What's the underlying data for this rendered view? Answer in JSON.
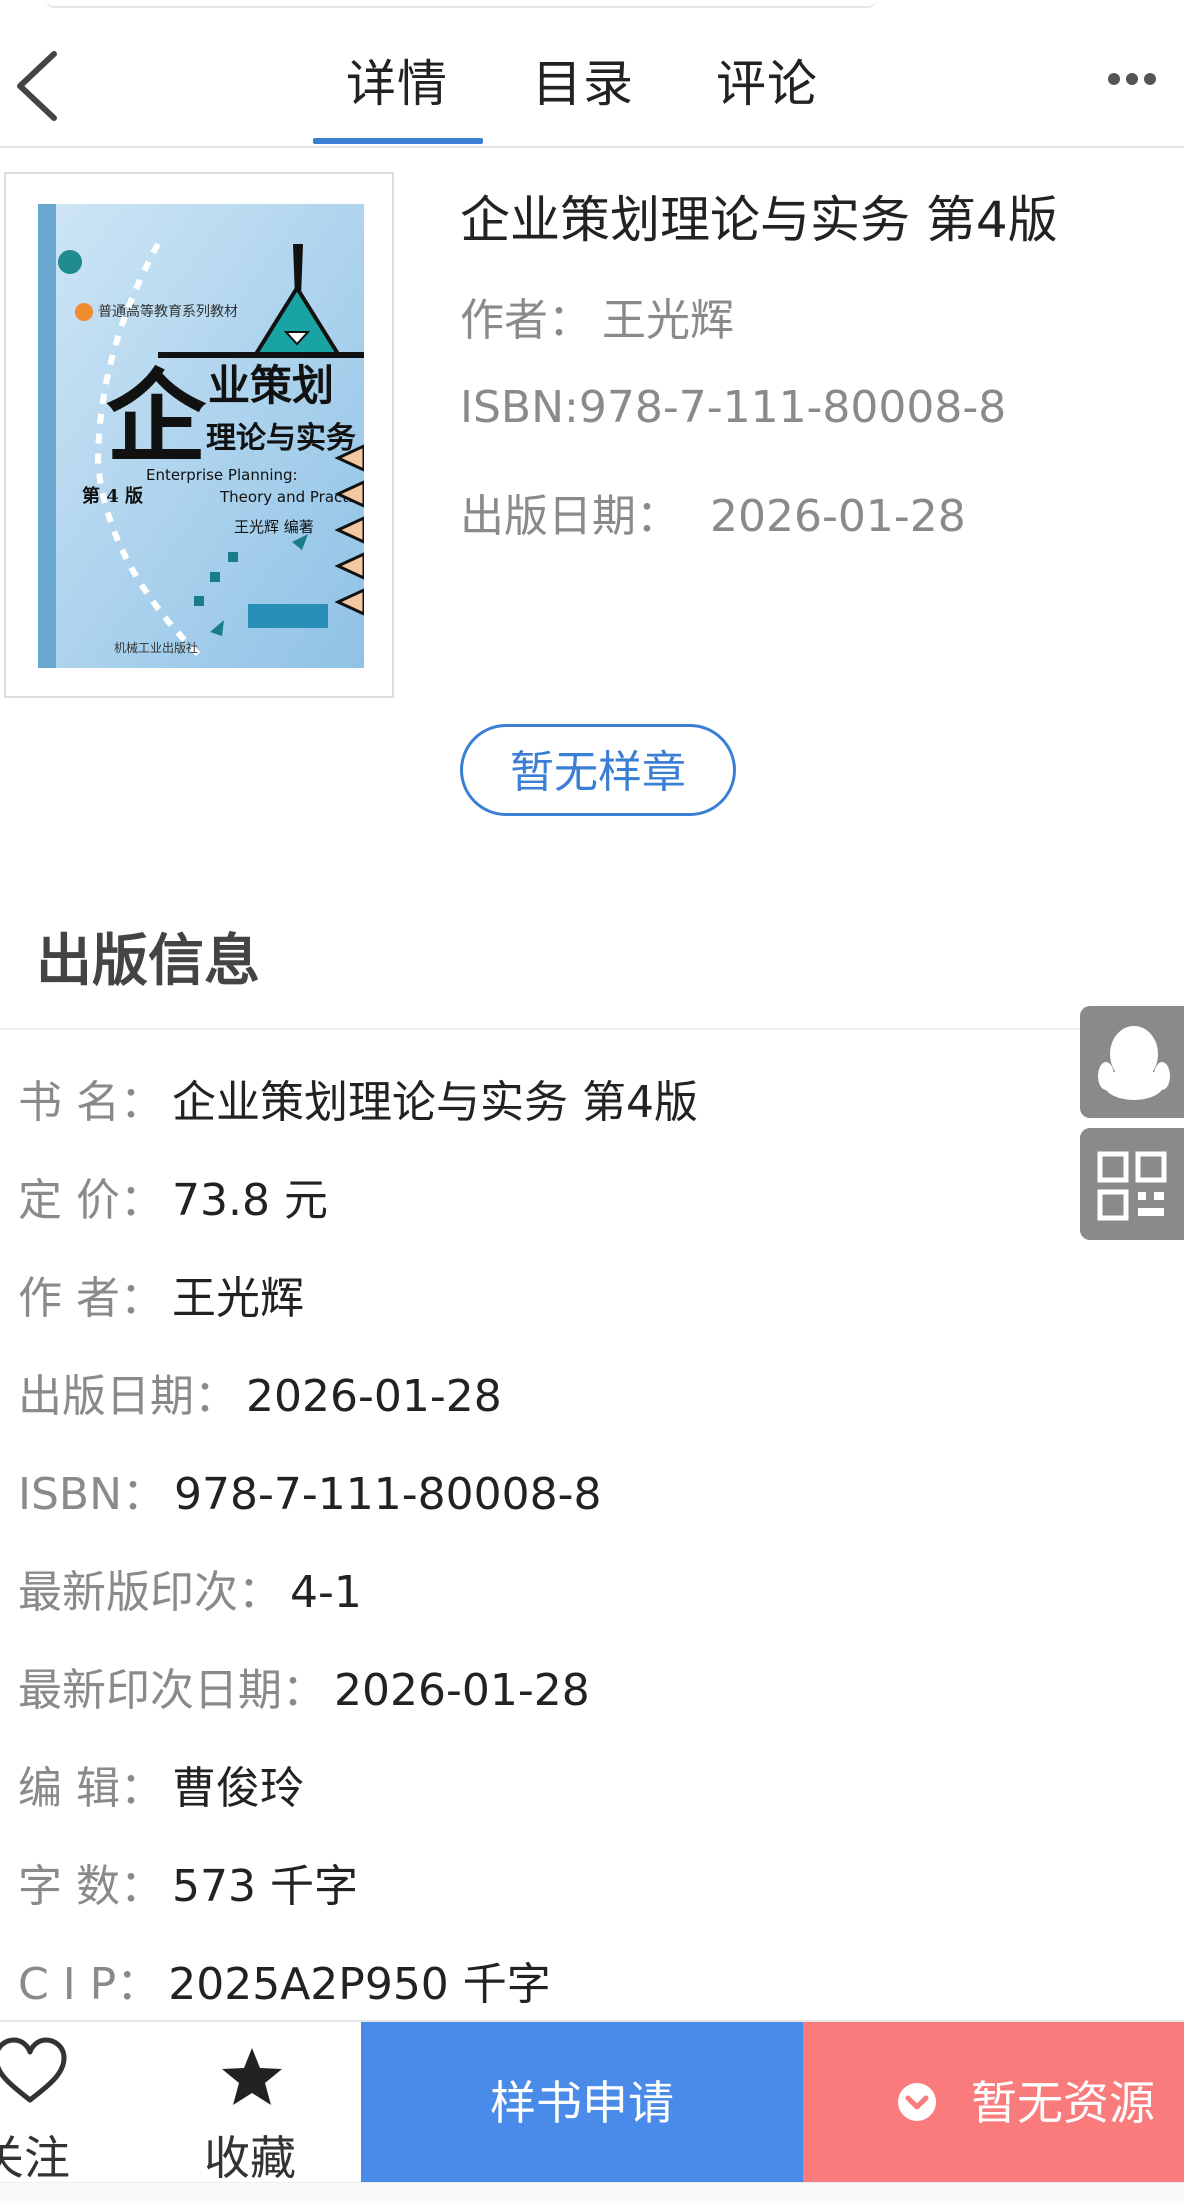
{
  "header": {
    "tabs": [
      "详情",
      "目录",
      "评论"
    ],
    "active_tab": "详情"
  },
  "book": {
    "title": "企业策划理论与实务 第4版",
    "author_label": "作者：",
    "author": "王光辉",
    "isbn_label": "ISBN:",
    "isbn": "978-7-111-80008-8",
    "date_label": "出版日期：",
    "date": "2026-01-28"
  },
  "cover": {
    "series": "普通高等教育系列教材",
    "title_big": "企",
    "title_line1": "业策划",
    "title_line2": "理论与实务",
    "subtitle_en_1": "Enterprise Planning:",
    "subtitle_en_2": "Theory and Practice",
    "edition": "第 4 版",
    "author": "王光辉  编著",
    "spine_title": "企业策划理论与实务",
    "publisher": "机械工业出版社"
  },
  "sample_button": "暂无样章",
  "publish_info": {
    "heading": "出版信息",
    "rows": [
      {
        "label": "书  名：",
        "value": "企业策划理论与实务 第4版"
      },
      {
        "label": "定  价：",
        "value": "73.8 元"
      },
      {
        "label": "作  者：",
        "value": "王光辉"
      },
      {
        "label": "出版日期：",
        "value": "2026-01-28"
      },
      {
        "label": "ISBN：",
        "value": "978-7-111-80008-8"
      },
      {
        "label": "最新版印次：",
        "value": "4-1"
      },
      {
        "label": "最新印次日期：",
        "value": "2026-01-28"
      },
      {
        "label": "编  辑：",
        "value": "曹俊玲"
      },
      {
        "label": "字  数：",
        "value": "573 千字"
      },
      {
        "label": "C I P：",
        "value": "2025A2P950 千字"
      }
    ]
  },
  "bottom_bar": {
    "follow": "关注",
    "favorite": "收藏",
    "apply": "样书申请",
    "no_resource": "暂无资源"
  },
  "colors": {
    "accent": "#3b7fd4",
    "apply_bg": "#4a8ae8",
    "no_resource_bg": "#f97b7b",
    "float_bg": "#8a8a8a"
  }
}
